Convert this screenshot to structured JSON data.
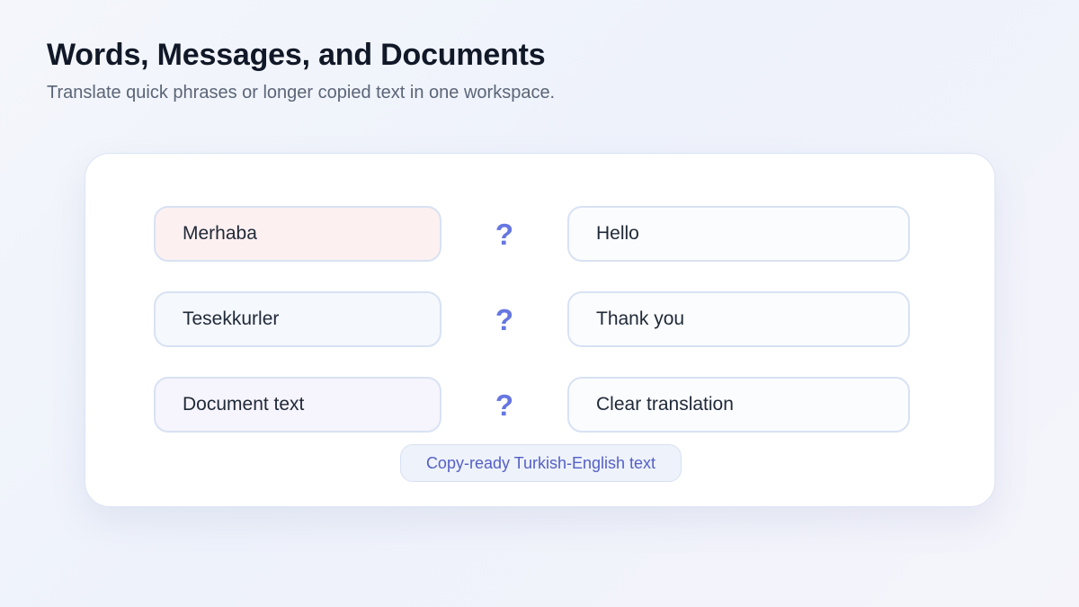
{
  "header": {
    "title": "Words, Messages, and Documents",
    "subtitle": "Translate quick phrases or longer copied text in one workspace."
  },
  "translations": [
    {
      "source": "Merhaba",
      "arrow": "?",
      "target": "Hello"
    },
    {
      "source": "Tesekkurler",
      "arrow": "?",
      "target": "Thank you"
    },
    {
      "source": "Document text",
      "arrow": "?",
      "target": "Clear translation"
    }
  ],
  "footer": {
    "label": "Copy-ready Turkish-English text"
  },
  "colors": {
    "accent": "#6676e0",
    "pill_text": "#5460c6",
    "source_pink": "#fdf0f1",
    "source_blue": "#f5f8fd",
    "source_lavender": "#f6f4fc"
  }
}
